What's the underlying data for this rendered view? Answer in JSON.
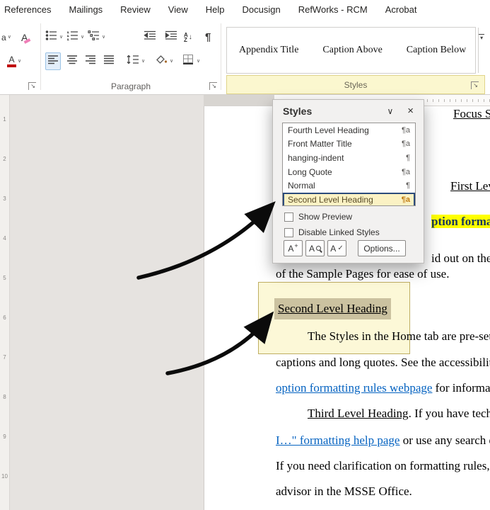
{
  "icons": {
    "caret": "∨",
    "chevron_down": "∨",
    "close": "×",
    "pilcrow": "¶",
    "dialog_launcher": "↘",
    "gallery_more": "▾",
    "sort_arrow": "↓",
    "letter_a_upper": "A",
    "letter_a_lower": "a",
    "letter_z": "Z",
    "plus": "+",
    "check": "✓"
  },
  "menu_bar": {
    "items": [
      {
        "label": "References"
      },
      {
        "label": "Mailings"
      },
      {
        "label": "Review"
      },
      {
        "label": "View"
      },
      {
        "label": "Help"
      },
      {
        "label": "Docusign"
      },
      {
        "label": "RefWorks - RCM"
      },
      {
        "label": "Acrobat"
      }
    ]
  },
  "ribbon": {
    "paragraph_group_label": "Paragraph"
  },
  "styles_gallery": {
    "group_label": "Styles",
    "items": [
      {
        "label": "Appendix Title"
      },
      {
        "label": "Caption Above"
      },
      {
        "label": "Caption Below"
      }
    ]
  },
  "styles_panel": {
    "title": "Styles",
    "items": [
      {
        "label": "Fourth Level Heading",
        "mark": "¶a",
        "selected": false
      },
      {
        "label": "Front Matter Title",
        "mark": "¶a",
        "selected": false
      },
      {
        "label": "hanging-indent",
        "mark": "¶",
        "selected": false
      },
      {
        "label": "Long Quote",
        "mark": "¶a",
        "selected": false
      },
      {
        "label": "Normal",
        "mark": "¶",
        "selected": false
      },
      {
        "label": "Second Level Heading",
        "mark": "¶a",
        "selected": true
      }
    ],
    "show_preview_label": "Show Preview",
    "disable_linked_styles_label": "Disable Linked Styles",
    "options_label": "Options..."
  },
  "ruler": {
    "numbers": [
      "1",
      "2",
      "3",
      "4",
      "5",
      "6",
      "7",
      "8",
      "9",
      "10"
    ]
  },
  "document": {
    "heading_fragment": "Focus State",
    "first_level_fragment": "First Lev",
    "highlighted_fragment": "ption formatt",
    "laid_out_fragment": "id out on the S",
    "sample_pages_line": "of the Sample Pages for ease of use.",
    "callout_heading": "Second Level Heading",
    "styles_home_line": "The Styles in the Home tab are pre-set f",
    "captions_line": "captions and long quotes. See the accessibility g",
    "option_formatting_link": "option formatting rules webpage",
    "for_information_fragment": " for informatio",
    "third_level_heading": "Third Level Heading",
    "technical_fragment": ". If you have techni",
    "help_page_link": "I…\" formatting help page",
    "search_engine_fragment": " or use any search eng",
    "clarification_line": "If you need clarification on formatting rules, pl",
    "advisor_line": "advisor in the MSSE Office."
  }
}
